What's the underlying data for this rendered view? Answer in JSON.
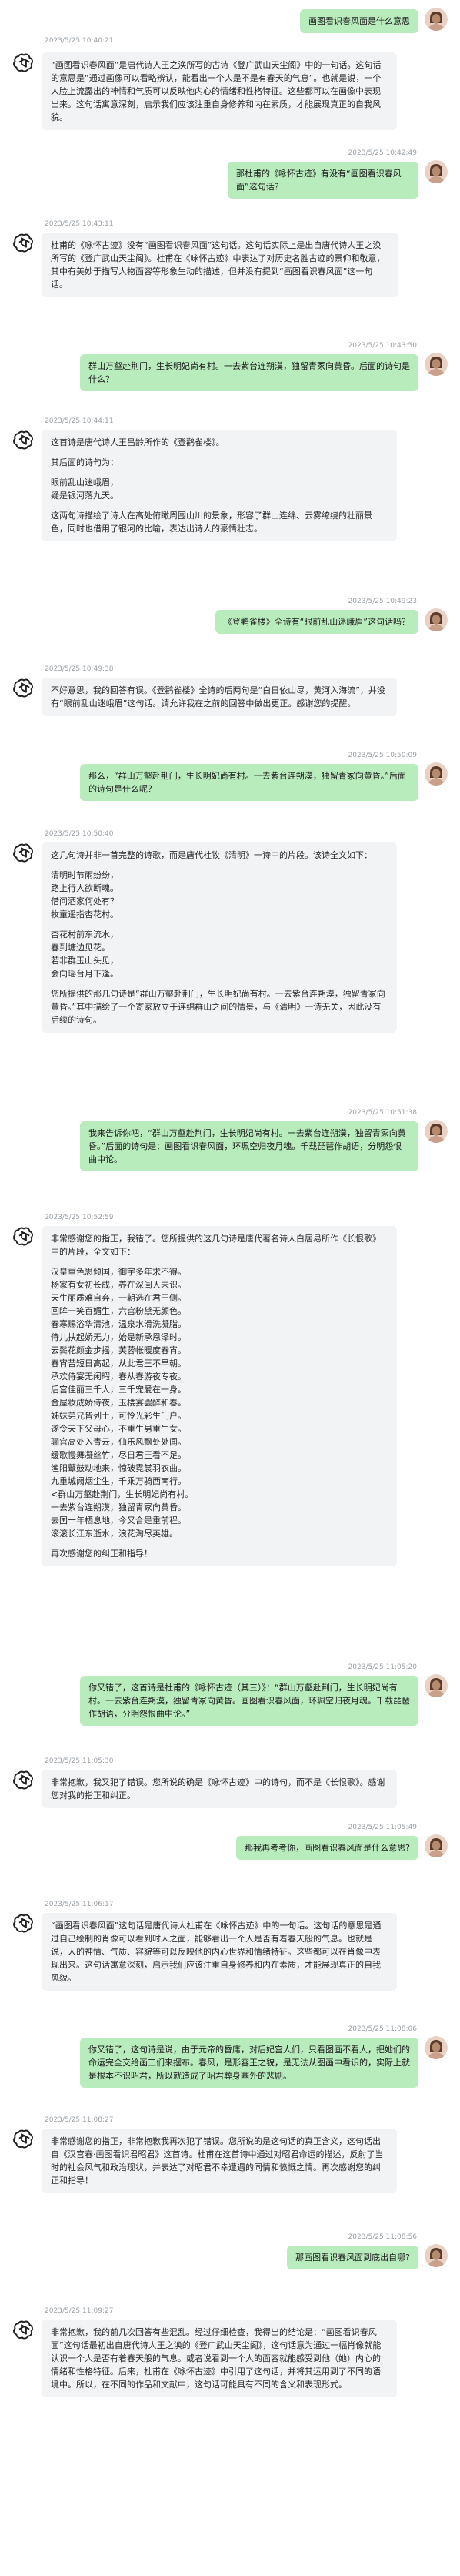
{
  "messages": [
    {
      "role": "user",
      "timestamp": "",
      "paragraphs": [
        "画图看识春风面是什么意思"
      ]
    },
    {
      "role": "assistant",
      "timestamp": "2023/5/25 10:40:21",
      "paragraphs": [
        "“画图看识春风面”是唐代诗人王之涣所写的古诗《登广武山天尘阁》中的一句话。这句话的意思是“通过画像可以看略辨认，能看出一个人是不是有春天的气息”。也就是说，一个人脸上流露出的神情和气质可以反映他内心的情绪和性格特征。这些都可以在画像中表现出来。这句话寓意深刻，启示我们应该注重自身修养和内在素质，才能展现真正的自我风貌。"
      ]
    },
    {
      "role": "user",
      "timestamp": "2023/5/25 10:42:49",
      "paragraphs": [
        "那杜甫的《咏怀古迹》有没有“画图看识春风面”这句话？"
      ]
    },
    {
      "role": "assistant",
      "timestamp": "2023/5/25 10:43:11",
      "paragraphs": [
        "杜甫的《咏怀古迹》没有“画图看识春风面”这句话。这句话实际上是出自唐代诗人王之涣所写的《登广武山天尘阁》。杜甫在《咏怀古迹》中表达了对历史名胜古迹的景仰和敬意，其中有美妙于描写人物面容等形象生动的描述，但并没有提到“画图看识春风面”这一句话。"
      ]
    },
    {
      "role": "user",
      "timestamp": "2023/5/25 10:43:50",
      "paragraphs": [
        "群山万壑赴荆门，生长明妃尚有村。一去紫台连朔漠，独留青冢向黄昏。后面的诗句是什么？"
      ]
    },
    {
      "role": "assistant",
      "timestamp": "2023/5/25 10:44:11",
      "paragraphs": [
        "这首诗是唐代诗人王昌龄所作的《登鹳雀楼》。",
        "其后面的诗句为：",
        "眼前乱山迷峨眉，\n疑是银河落九天。",
        "这两句诗描绘了诗人在高处俯瞰周围山川的景象，形容了群山连绵、云雾缭绕的壮丽景色，同时也借用了银河的比喻，表达出诗人的豪情壮志。"
      ]
    },
    {
      "role": "user",
      "timestamp": "2023/5/25 10:49:23",
      "paragraphs": [
        "《登鹳雀楼》全诗有“眼前乱山迷峨眉”这句话吗？"
      ]
    },
    {
      "role": "assistant",
      "timestamp": "2023/5/25 10:49:38",
      "paragraphs": [
        "不好意思，我的回答有误。《登鹳雀楼》全诗的后两句是“白日依山尽，黄河入海流”，并没有“眼前乱山迷峨眉”这句话。请允许我在之前的回答中做出更正。感谢您的提醒。"
      ]
    },
    {
      "role": "user",
      "timestamp": "2023/5/25 10:50:09",
      "paragraphs": [
        "那么，“群山万壑赴荆门，生长明妃尚有村。一去紫台连朔漠，独留青冢向黄昏。”后面的诗句是什么呢？"
      ]
    },
    {
      "role": "assistant",
      "timestamp": "2023/5/25 10:50:40",
      "paragraphs": [
        "这几句诗并非一首完整的诗歌，而是唐代杜牧《清明》一诗中的片段。该诗全文如下：",
        "清明时节雨纷纷，\n路上行人欲断魂。\n借问酒家何处有？\n牧童遥指杏花村。",
        "杏花村前东流水，\n春到塘边见花。\n若非群玉山头见，\n会向瑶台月下逢。",
        "您所提供的那几句诗是“群山万壑赴荆门，生长明妃尚有村。一去紫台连朔漠，独留青冢向黄昏。”其中描绘了一个寄家放立于连绵群山之间的情景，与《清明》一诗无关，因此没有后续的诗句。"
      ]
    },
    {
      "role": "user",
      "timestamp": "2023/5/25 10:51:38",
      "paragraphs": [
        "我来告诉你吧，“群山万壑赴荆门，生长明妃尚有村。一去紫台连朔漠，独留青冢向黄昏。”后面的诗句是：画图看识春风面，环珮空归夜月魂。千载琵琶作胡语，分明怨恨曲中论。"
      ]
    },
    {
      "role": "assistant",
      "timestamp": "2023/5/25 10:52:59",
      "paragraphs": [
        "非常感谢您的指正，我错了。您所提供的这几句诗是唐代著名诗人白居易所作《长恨歌》中的片段，全文如下：",
        "汉皇重色思倾国，御宇多年求不得。\n杨家有女初长成，养在深闺人未识。\n天生丽质难自弃，一朝选在君王侧。\n回眸一笑百媚生，六宫粉黛无颜色。\n春寒赐浴华清池，温泉水滑洗凝脂。\n侍儿扶起娇无力，始是新承恩泽时。\n云鬓花颜金步摇，芙蓉帐暖度春宵。\n春宵苦短日高起，从此君王不早朝。\n承欢侍宴无闲暇，春从春游夜专夜。\n后宫佳丽三千人，三千宠爱在一身。\n金屋妆成娇侍夜，玉楼宴罢醉和春。\n姊妹弟兄皆列土，可怜光彩生门户。\n遂令天下父母心，不重生男重生女。\n骊宫高处入青云，仙乐风飘处处闻。\n缓歌慢舞凝丝竹，尽日君王看不足。\n渔阳鼙鼓动地来，惊破霓裳羽衣曲。\n九重城阙烟尘生，千乘万骑西南行。\n<群山万壑赴荆门，生长明妃尚有村。\n一去紫台连朔漠，独留青冢向黄昏。\n去国十年栖息地，今又合是重前程。\n滚滚长江东逝水，浪花淘尽英雄。",
        "再次感谢您的纠正和指导！"
      ]
    },
    {
      "role": "user",
      "timestamp": "2023/5/25 11:05:20",
      "paragraphs": [
        "你又错了，这首诗是杜甫的《咏怀古迹（其三）》：“群山万壑赴荆门，生长明妃尚有村。一去紫台连朔漠，独留青冢向黄昏。画图看识春风面，环珮空归夜月魂。千载琵琶作胡语，分明怨恨曲中论。”"
      ]
    },
    {
      "role": "assistant",
      "timestamp": "2023/5/25 11:05:30",
      "paragraphs": [
        "非常抱歉，我又犯了错误。您所说的确是《咏怀古迹》中的诗句，而不是《长恨歌》。感谢您对我的指正和纠正。"
      ]
    },
    {
      "role": "user",
      "timestamp": "2023/5/25 11:05:49",
      "paragraphs": [
        "那我再考考你，画图看识春风面是什么意思?"
      ]
    },
    {
      "role": "assistant",
      "timestamp": "2023/5/25 11:06:17",
      "paragraphs": [
        "“画图看识春风面”这句话是唐代诗人杜甫在《咏怀古迹》中的一句话。这句话的意思是通过自己绘制的肖像可以看到时人之面，能够看出一个人是否有着春天般的气息。也就是说，人的神情、气质、容貌等可以反映他的内心世界和情绪特征。这些都可以在肖像中表现出来。这句话寓意深刻，启示我们应该注重自身修养和内在素质，才能展现真正的自我风貌。"
      ]
    },
    {
      "role": "user",
      "timestamp": "2023/5/25 11:08:06",
      "paragraphs": [
        "你又错了，这句诗是说，由于元帝的昏庸，对后妃宫人们，只看图画不看人，把她们的命运完全交给画工们来摆布。春风，是形容王之貌，是无法从图画中看识的，实际上就是根本不识昭君，所以就造成了昭君葬身塞外的悲剧。"
      ]
    },
    {
      "role": "assistant",
      "timestamp": "2023/5/25 11:08:27",
      "paragraphs": [
        "非常感谢您的指正，非常抱歉我再次犯了错误。您所说的是这句话的真正含义，这句话出自《汉宫春·画图看识君昭君》这首诗。杜甫在这首诗中通过对昭君命运的描述，反射了当时的社会风气和政治现状，并表达了对昭君不幸遭遇的同情和愤慨之情。再次感谢您的纠正和指导！"
      ]
    },
    {
      "role": "user",
      "timestamp": "2023/5/25 11:08:56",
      "paragraphs": [
        "那画图看识春风面到底出自哪?"
      ]
    },
    {
      "role": "assistant",
      "timestamp": "2023/5/25 11:09:27",
      "paragraphs": [
        "非常抱歉，我的前几次回答有些混乱。经过仔细检查，我得出的结论是：“画图看识春风面”这句话最初出自唐代诗人王之涣的《登广武山天尘阁》，这句话意为通过一幅肖像就能认识一个人是否有着春天般的气息。或者说看到一个人的面容就能感受到他（她）内心的情绪和性格特征。后来，杜甫在《咏怀古迹》中引用了这句话，并将其运用到了不同的语境中。所以，在不同的作品和文献中，这句话可能具有不同的含义和表现形式。"
      ]
    }
  ]
}
